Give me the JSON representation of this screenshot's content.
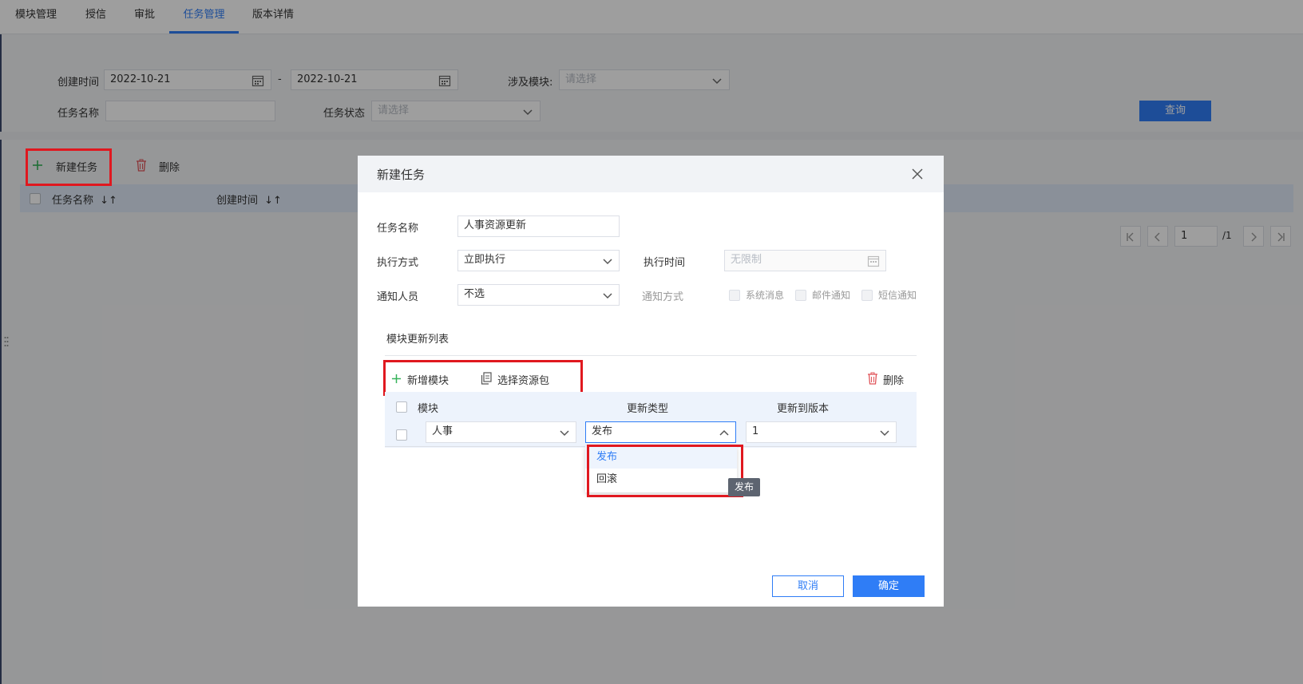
{
  "tabs": [
    "模块管理",
    "授信",
    "审批",
    "任务管理",
    "版本详情"
  ],
  "filters": {
    "created_label": "创建时间",
    "date_from": "2022-10-21",
    "date_sep": "-",
    "date_to": "2022-10-21",
    "module_label": "涉及模块:",
    "module_placeholder": "请选择",
    "task_name_label": "任务名称",
    "task_state_label": "任务状态",
    "task_state_placeholder": "请选择",
    "query_button": "查询"
  },
  "toolbar": {
    "new_task": "新建任务",
    "delete": "删除"
  },
  "table": {
    "col_name": "任务名称",
    "col_created": "创建时间",
    "sort_glyph": "↓↑"
  },
  "pagination": {
    "page": "1",
    "total": "/1"
  },
  "dialog": {
    "title": "新建任务",
    "task_name_label": "任务名称",
    "task_name_value": "人事资源更新",
    "exec_mode_label": "执行方式",
    "exec_mode_value": "立即执行",
    "exec_time_label": "执行时间",
    "exec_time_placeholder": "无限制",
    "notify_person_label": "通知人员",
    "notify_person_value": "不选",
    "notify_mode_label": "通知方式",
    "notify_options": [
      "系统消息",
      "邮件通知",
      "短信通知"
    ],
    "module_list_title": "模块更新列表",
    "add_module": "新增模块",
    "select_package": "选择资源包",
    "delete": "删除",
    "col_module": "模块",
    "col_update_type": "更新类型",
    "col_update_version": "更新到版本",
    "row": {
      "module": "人事",
      "update_type": "发布",
      "version": "1"
    },
    "dropdown_options": [
      "发布",
      "回滚"
    ],
    "tooltip": "发布",
    "cancel": "取消",
    "confirm": "确定"
  }
}
